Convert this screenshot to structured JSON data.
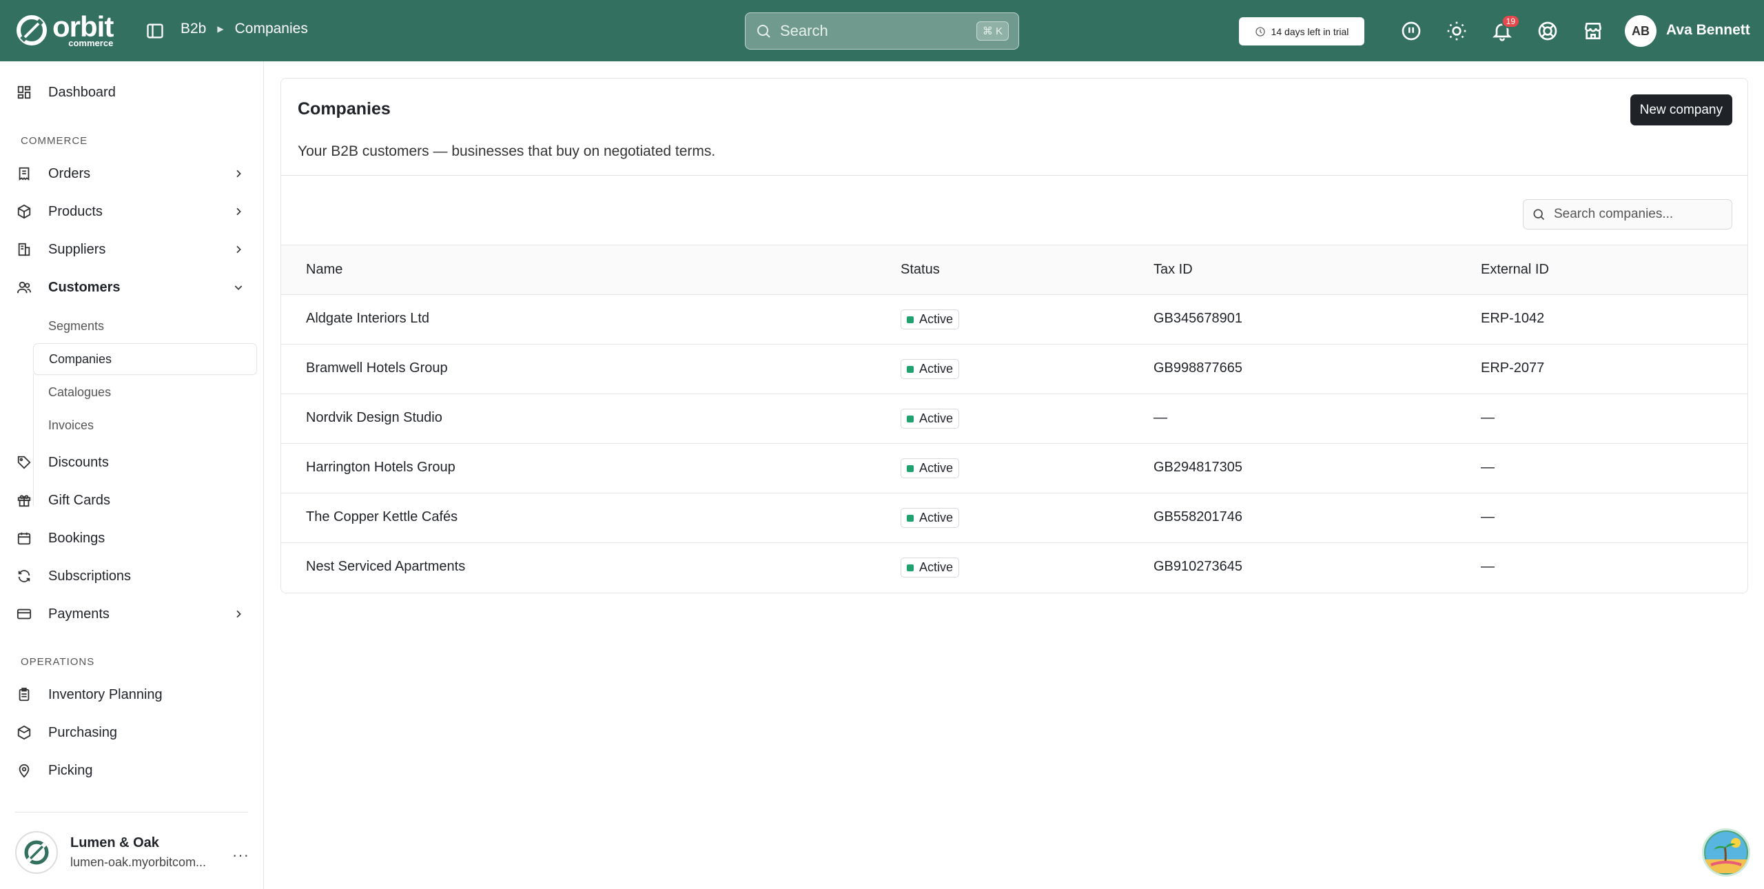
{
  "header": {
    "logo_text": "orbit",
    "logo_sub": "commerce",
    "breadcrumb": [
      "B2b",
      "Companies"
    ],
    "search_placeholder": "Search",
    "search_shortcut": "⌘ K",
    "trial_label": "14 days left in trial",
    "notification_count": "19",
    "user_initials": "AB",
    "user_name": "Ava Bennett",
    "brand_color": "#33705f"
  },
  "sidebar": {
    "dashboard": "Dashboard",
    "section_commerce": "COMMERCE",
    "orders": "Orders",
    "products": "Products",
    "suppliers": "Suppliers",
    "customers": "Customers",
    "sub": [
      "Segments",
      "Companies",
      "Catalogues",
      "Invoices"
    ],
    "discounts": "Discounts",
    "gift_cards": "Gift Cards",
    "bookings": "Bookings",
    "subscriptions": "Subscriptions",
    "payments": "Payments",
    "section_operations": "OPERATIONS",
    "inventory_planning": "Inventory Planning",
    "purchasing": "Purchasing",
    "picking": "Picking",
    "store_name": "Lumen & Oak",
    "store_url": "lumen-oak.myorbitcom...",
    "more": "···"
  },
  "main": {
    "title": "Companies",
    "new_button": "New company",
    "description": "Your B2B customers — businesses that buy on negotiated terms.",
    "search_placeholder": "Search companies...",
    "columns": [
      "Name",
      "Status",
      "Tax ID",
      "External ID"
    ],
    "rows": [
      {
        "name": "Aldgate Interiors Ltd",
        "status": "Active",
        "tax_id": "GB345678901",
        "external_id": "ERP-1042"
      },
      {
        "name": "Bramwell Hotels Group",
        "status": "Active",
        "tax_id": "GB998877665",
        "external_id": "ERP-2077"
      },
      {
        "name": "Nordvik Design Studio",
        "status": "Active",
        "tax_id": "—",
        "external_id": "—"
      },
      {
        "name": "Harrington Hotels Group",
        "status": "Active",
        "tax_id": "GB294817305",
        "external_id": "—"
      },
      {
        "name": "The Copper Kettle Cafés",
        "status": "Active",
        "tax_id": "GB558201746",
        "external_id": "—"
      },
      {
        "name": "Nest Serviced Apartments",
        "status": "Active",
        "tax_id": "GB910273645",
        "external_id": "—"
      }
    ]
  }
}
